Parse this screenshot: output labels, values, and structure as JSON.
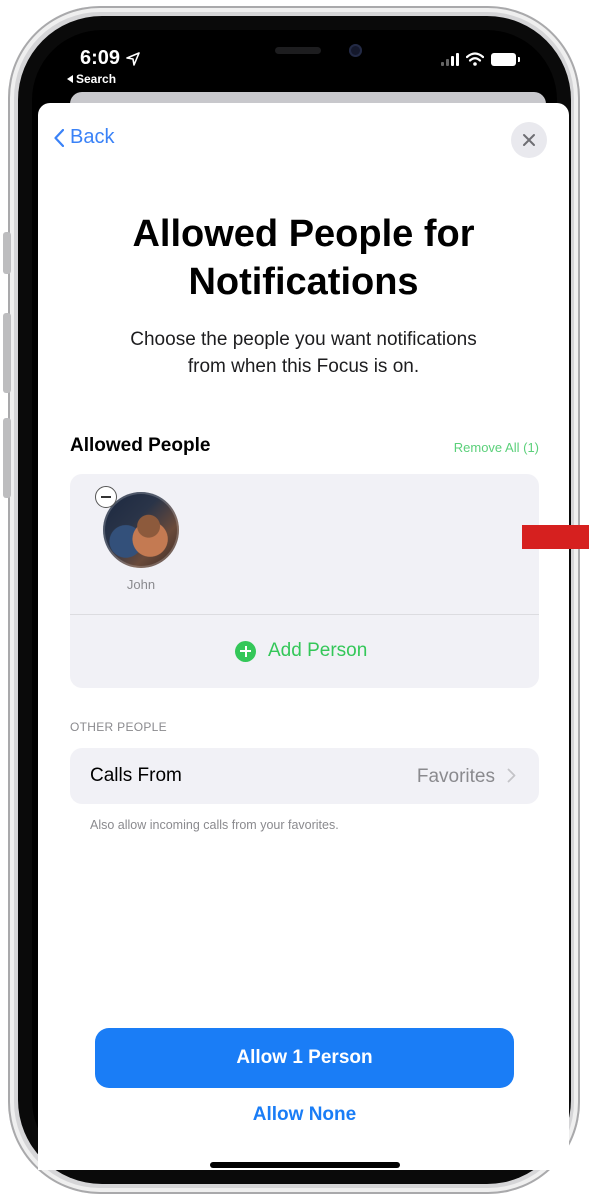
{
  "status_bar": {
    "time": "6:09",
    "back_app": "Search"
  },
  "nav": {
    "back_label": "Back"
  },
  "header": {
    "title_line1": "Allowed People for",
    "title_line2": "Notifications",
    "subtitle_line1": "Choose the people you want notifications",
    "subtitle_line2": "from when this Focus is on."
  },
  "allowed_people": {
    "section_label": "Allowed People",
    "remove_all_label": "Remove All (1)",
    "people": [
      {
        "name": "John"
      }
    ],
    "add_person_label": "Add Person"
  },
  "other_people": {
    "section_label": "OTHER PEOPLE",
    "calls_from_label": "Calls From",
    "calls_from_value": "Favorites",
    "calls_note": "Also allow incoming calls from your favorites."
  },
  "actions": {
    "primary_label": "Allow 1 Person",
    "secondary_label": "Allow None"
  },
  "colors": {
    "accent_blue": "#1a7df6",
    "green": "#34c759",
    "marker_red": "#d6201f"
  }
}
